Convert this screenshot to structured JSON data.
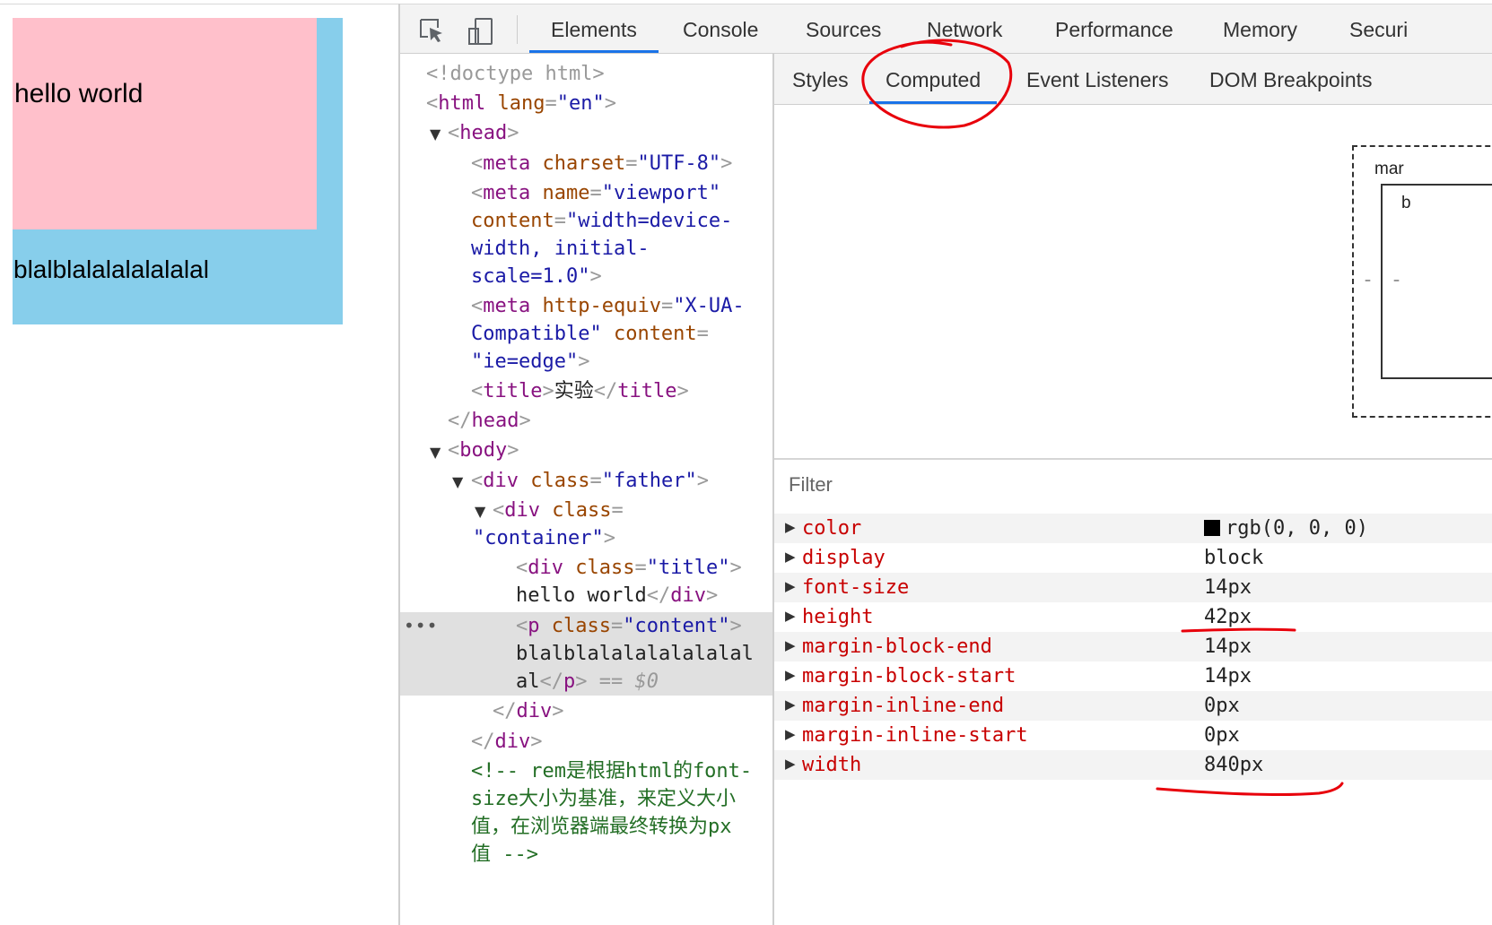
{
  "preview": {
    "title_text": "hello world",
    "content_text": "blalblalalalalalalal",
    "father_color": "#87ceeb",
    "title_color": "#ffc0cb"
  },
  "toolbar": {
    "inspect_icon": "inspect-element-icon",
    "device_icon": "device-toolbar-icon",
    "tabs": [
      "Elements",
      "Console",
      "Sources",
      "Network",
      "Performance",
      "Memory",
      "Securi"
    ],
    "active_tab": "Elements"
  },
  "tree": {
    "doctype": "<!doctype html>",
    "html_tag": "html",
    "html_attr": "lang",
    "html_val": "\"en\"",
    "head": "head",
    "meta1_attr": "charset",
    "meta1_val": "\"UTF-8\"",
    "meta2_attr": "name",
    "meta2_val": "\"viewport\"",
    "meta2_l2_attr": "content",
    "meta2_l2_val": "\"width=device-",
    "meta2_l3": "width, initial-",
    "meta2_l4": "scale=1.0\"",
    "meta3_attr": "http-equiv",
    "meta3_val": "\"X-UA-",
    "meta3_l2_val": "Compatible\"",
    "meta3_l2_attr": "content",
    "meta3_l3_val": "\"ie=edge\"",
    "title_tag": "title",
    "title_text": "实验",
    "head_close": "head",
    "body": "body",
    "div_father_attr": "class",
    "div_father_val": "\"father\"",
    "div_container_attr": "class",
    "div_container_val": "\"container\"",
    "div_title_attr": "class",
    "div_title_val": "\"title\"",
    "div_title_text": "hello world",
    "p_attr": "class",
    "p_val": "\"content\"",
    "p_text_l1": "blalblalalalalalalal",
    "p_text_l2": "al",
    "eq_sel": "== $0",
    "comment_l1": "<!-- rem是根据html的font-",
    "comment_l2": "size大小为基准，来定义大小",
    "comment_l3": "值，在浏览器端最终转换为px",
    "comment_l4": "值 -->",
    "dots": "•••"
  },
  "subtabs": {
    "items": [
      "Styles",
      "Computed",
      "Event Listeners",
      "DOM Breakpoints"
    ],
    "active": "Computed"
  },
  "boxmodel": {
    "outer_label": "mar",
    "inner_label": "b",
    "dash": "–"
  },
  "filter": {
    "placeholder": "Filter"
  },
  "computed": [
    {
      "name": "color",
      "value": "rgb(0, 0, 0)",
      "swatch": "#000000"
    },
    {
      "name": "display",
      "value": "block"
    },
    {
      "name": "font-size",
      "value": "14px"
    },
    {
      "name": "height",
      "value": "42px"
    },
    {
      "name": "margin-block-end",
      "value": "14px"
    },
    {
      "name": "margin-block-start",
      "value": "14px"
    },
    {
      "name": "margin-inline-end",
      "value": "0px"
    },
    {
      "name": "margin-inline-start",
      "value": "0px"
    },
    {
      "name": "width",
      "value": "840px"
    }
  ],
  "annotation_color": "#e8000b"
}
